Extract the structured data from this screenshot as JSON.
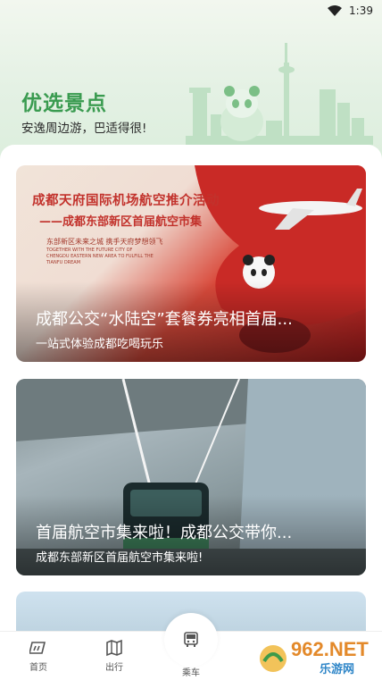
{
  "statusbar": {
    "time": "1:39"
  },
  "header": {
    "title": "优选景点",
    "subtitle": "安逸周边游，巴适得很!"
  },
  "cards": [
    {
      "poster_line1": "成都天府国际机场航空推介活动",
      "poster_line2": "——成都东部新区首届航空市集",
      "poster_line3": "东部新区未来之城   携手天府梦想领飞",
      "poster_line4": "TOGETHER WITH THE FUTURE CITY OF CHENGDU EASTERN NEW AREA TO FULFILL THE TIANFU DREAM",
      "title": "成都公交“水陆空”套餐券亮相首届...",
      "subtitle": "一站式体验成都吃喝玩乐"
    },
    {
      "title": "首届航空市集来啦！成都公交带你...",
      "subtitle": "成都东部新区首届航空市集来啦!"
    }
  ],
  "tabs": {
    "home": "首页",
    "travel": "出行",
    "ride": "乘车"
  },
  "watermark": {
    "main": "962.NET",
    "sub": "乐游网"
  },
  "colors": {
    "accent": "#3a9b50",
    "brand_red": "#c2322c"
  }
}
